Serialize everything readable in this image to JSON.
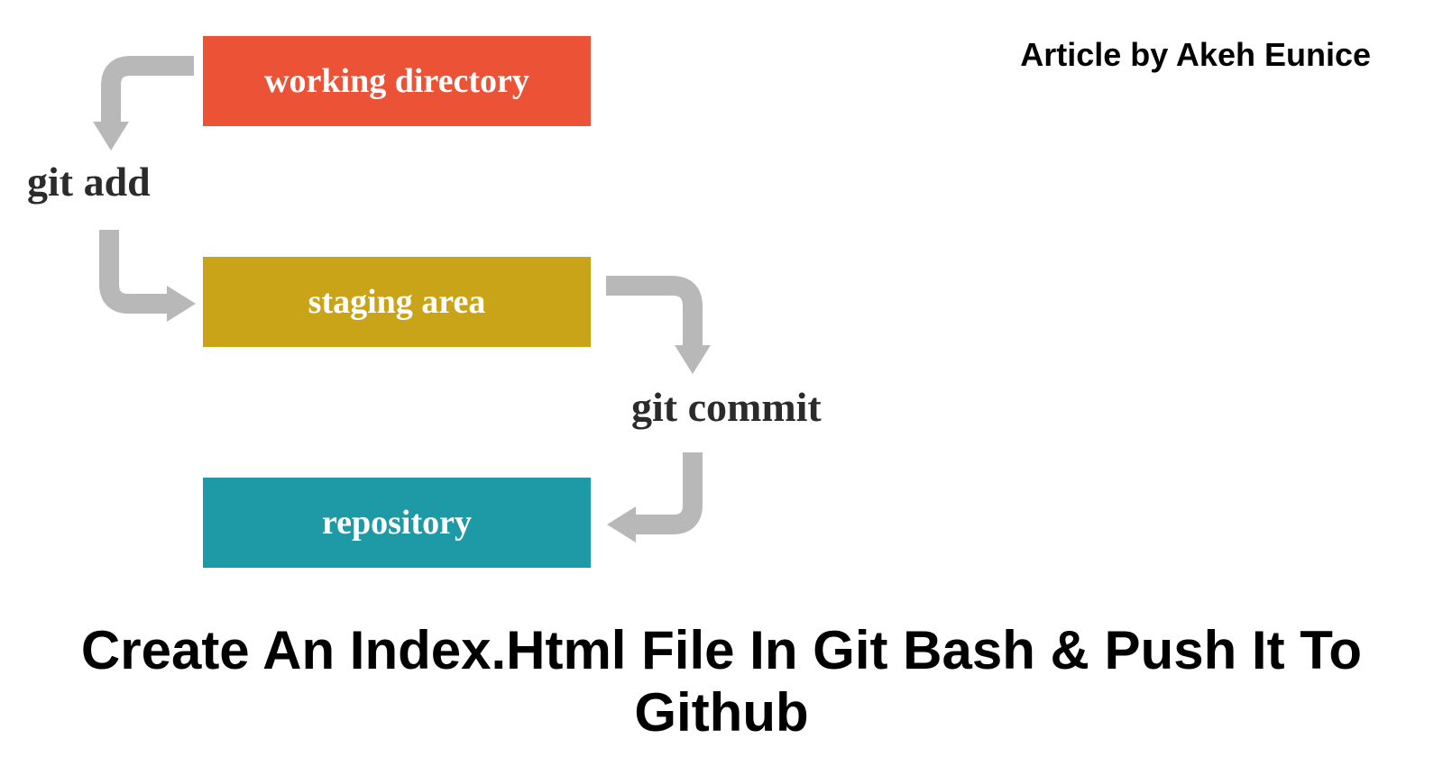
{
  "byline": "Article by Akeh Eunice",
  "boxes": {
    "working": "working directory",
    "staging": "staging area",
    "repository": "repository"
  },
  "labels": {
    "add": "git add",
    "commit": "git commit"
  },
  "title": "Create An Index.Html File In Git Bash & Push It To Github",
  "colors": {
    "arrow": "#b8b8b8",
    "working": "#ec5336",
    "staging": "#c9a418",
    "repository": "#1e9aa6"
  }
}
